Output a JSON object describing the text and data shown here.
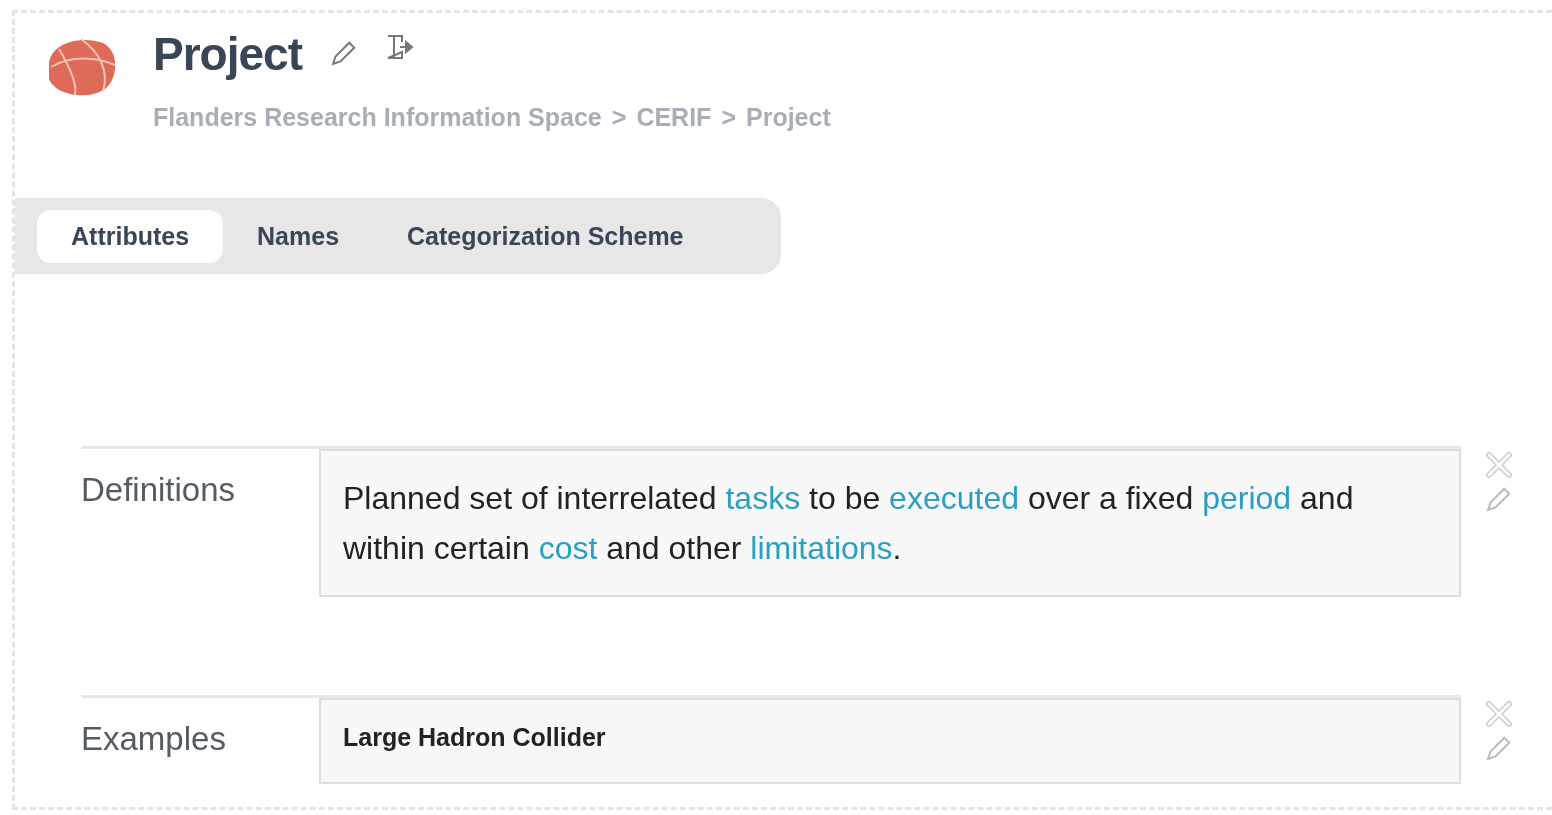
{
  "header": {
    "title": "Project",
    "breadcrumb": [
      "Flanders Research Information Space",
      "CERIF",
      "Project"
    ],
    "separator": ">"
  },
  "tabs": [
    {
      "label": "Attributes",
      "selected": true
    },
    {
      "label": "Names",
      "selected": false
    },
    {
      "label": "Categorization Scheme",
      "selected": false
    }
  ],
  "attributes": [
    {
      "label": "Definitions",
      "kind": "rich",
      "segments": [
        {
          "text": "Planned set of interrelated ",
          "link": false
        },
        {
          "text": "tasks",
          "link": true
        },
        {
          "text": " to be ",
          "link": false
        },
        {
          "text": "executed",
          "link": true
        },
        {
          "text": " over a fixed ",
          "link": false
        },
        {
          "text": "period",
          "link": true
        },
        {
          "text": " and within certain ",
          "link": false
        },
        {
          "text": "cost",
          "link": true
        },
        {
          "text": " and other ",
          "link": false
        },
        {
          "text": "limitations",
          "link": true
        },
        {
          "text": ".",
          "link": false
        }
      ]
    },
    {
      "label": "Examples",
      "kind": "plain",
      "value": "Large Hadron Collider"
    }
  ]
}
